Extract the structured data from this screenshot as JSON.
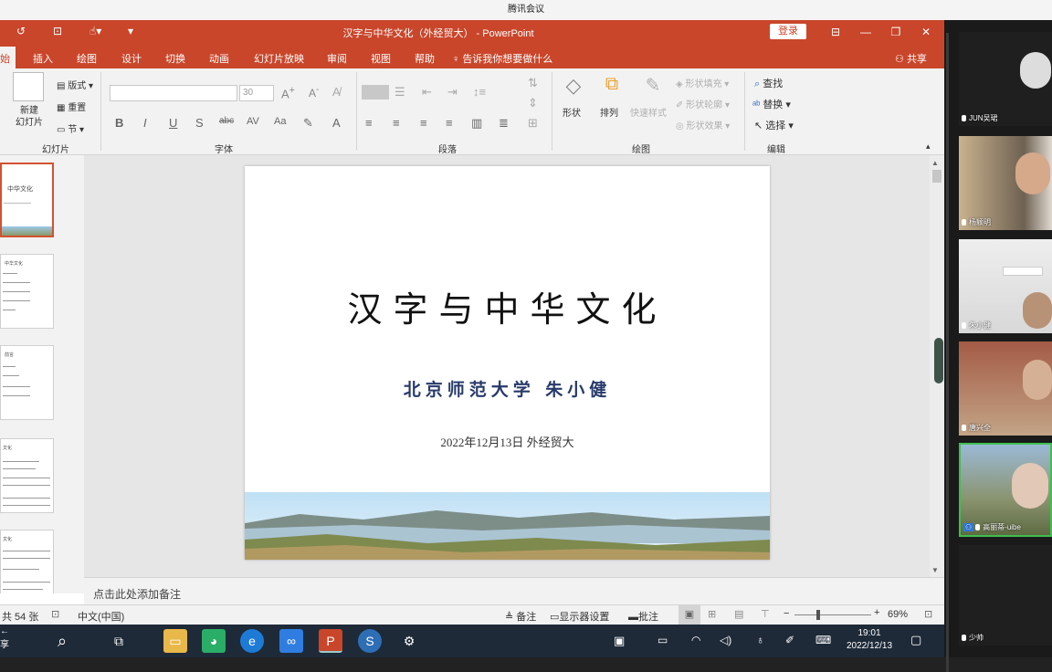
{
  "meeting": {
    "title": "腾讯会议"
  },
  "ppt": {
    "window_title": "汉字与中华文化（外经贸大）  -  PowerPoint",
    "login": "登录",
    "tabs": [
      "始",
      "插入",
      "绘图",
      "设计",
      "切换",
      "动画",
      "幻灯片放映",
      "审阅",
      "视图",
      "帮助"
    ],
    "tell_me": "告诉我你想要做什么",
    "share": "共享",
    "ribbon": {
      "new_slide": "新建\n幻灯片",
      "layout": "版式",
      "reset": "重置",
      "section": "节",
      "font_size": "30",
      "shape": "形状",
      "arrange": "排列",
      "quick_styles": "快速样式",
      "shape_fill": "形状填充",
      "shape_outline": "形状轮廓",
      "shape_effects": "形状效果",
      "find": "查找",
      "replace": "替换",
      "select": "选择",
      "groups": {
        "slides": "幻灯片",
        "font": "字体",
        "paragraph": "段落",
        "drawing": "绘图",
        "editing": "编辑"
      }
    },
    "thumbnails": [
      {
        "title": "中华文化"
      },
      {
        "title": "中华文化"
      },
      {
        "title": "前言"
      },
      {
        "title": "文化"
      },
      {
        "title": "文化"
      }
    ],
    "slide": {
      "title": "汉字与中华文化",
      "subtitle": "北京师范大学  朱小健",
      "date": "2022年12月13日    外经贸大"
    },
    "notes_placeholder": "点击此处添加备注",
    "status": {
      "slide_count": "共 54 张",
      "language": "中文(中国)",
      "notes": "备注",
      "presenter": "显示器设置",
      "comments": "批注",
      "zoom": "69%"
    }
  },
  "taskbar": {
    "time": "19:01",
    "date": "2022/12/13",
    "left_text": "享"
  },
  "participants": [
    {
      "name": "JUN吴珺"
    },
    {
      "name": "杨颖明"
    },
    {
      "name": "朱小健"
    },
    {
      "name": "唐兴全"
    },
    {
      "name": "高丽蒂-uibe"
    },
    {
      "name": "少帅"
    }
  ],
  "colors": {
    "ppt_red": "#c9462b",
    "accent_green": "#3fbf4f",
    "slide_subtitle": "#273a6a"
  }
}
